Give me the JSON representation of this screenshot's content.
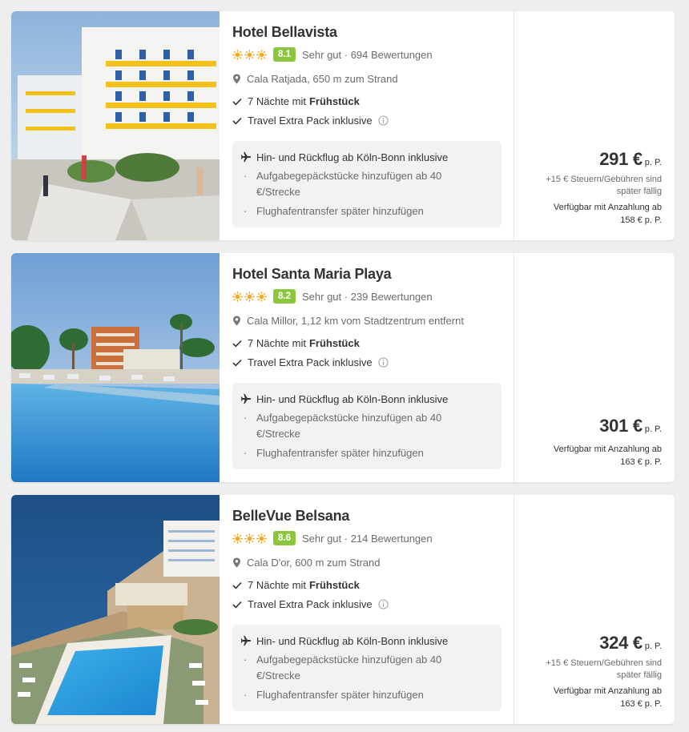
{
  "hotels": [
    {
      "name": "Hotel Bellavista",
      "stars": 3,
      "score": "8.1",
      "score_text": "Sehr gut · 694 Bewertungen",
      "location": "Cala Ratjada, 650 m zum Strand",
      "nights_prefix": "7 Nächte mit",
      "board": "Frühstück",
      "extra": "Travel Extra Pack inklusive",
      "flight": "Hin- und Rückflug ab Köln-Bonn inklusive",
      "bullets": [
        "Aufgabegepäckstücke hinzufügen ab 40 €/Strecke",
        "Flughafentransfer später hinzufügen"
      ],
      "price": "291 €",
      "per_person": "p. P.",
      "tax_note": "+15 € Steuern/Gebühren sind später fällig",
      "deposit_line1": "Verfügbar mit Anzahlung ab",
      "deposit_line2": "158 € p. P."
    },
    {
      "name": "Hotel Santa Maria Playa",
      "stars": 3,
      "score": "8.2",
      "score_text": "Sehr gut · 239 Bewertungen",
      "location": "Cala Millor, 1,12 km vom Stadtzentrum entfernt",
      "nights_prefix": "7 Nächte mit",
      "board": "Frühstück",
      "extra": "Travel Extra Pack inklusive",
      "flight": "Hin- und Rückflug ab Köln-Bonn inklusive",
      "bullets": [
        "Aufgabegepäckstücke hinzufügen ab 40 €/Strecke",
        "Flughafentransfer später hinzufügen"
      ],
      "price": "301 €",
      "per_person": "p. P.",
      "tax_note": "",
      "deposit_line1": "Verfügbar mit Anzahlung ab",
      "deposit_line2": "163 € p. P."
    },
    {
      "name": "BelleVue Belsana",
      "stars": 3,
      "score": "8.6",
      "score_text": "Sehr gut · 214 Bewertungen",
      "location": "Cala D'or, 600 m zum Strand",
      "nights_prefix": "7 Nächte mit",
      "board": "Frühstück",
      "extra": "Travel Extra Pack inklusive",
      "flight": "Hin- und Rückflug ab Köln-Bonn inklusive",
      "bullets": [
        "Aufgabegepäckstücke hinzufügen ab 40 €/Strecke",
        "Flughafentransfer später hinzufügen"
      ],
      "price": "324 €",
      "per_person": "p. P.",
      "tax_note": "+15 € Steuern/Gebühren sind später fällig",
      "deposit_line1": "Verfügbar mit Anzahlung ab",
      "deposit_line2": "163 € p. P."
    }
  ],
  "colors": {
    "score_badge": "#8cc63f",
    "sun": "#f5a623",
    "flight_box": "#f2f2f2"
  },
  "icons": {
    "sun": "sun-icon",
    "pin": "map-pin-icon",
    "check": "check-icon",
    "info": "info-icon",
    "plane": "plane-icon"
  }
}
